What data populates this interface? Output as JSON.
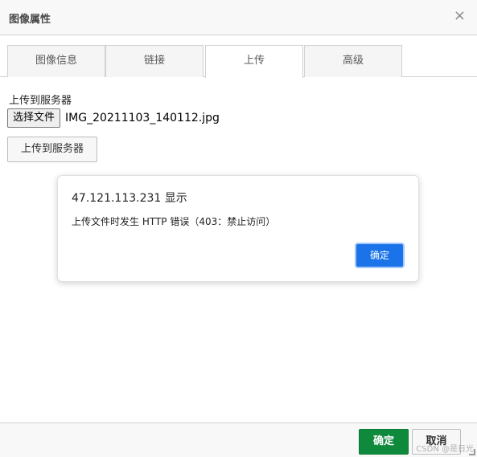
{
  "dialog": {
    "title": "图像属性",
    "close_icon": "×"
  },
  "tabs": [
    {
      "label": "图像信息",
      "active": false
    },
    {
      "label": "链接",
      "active": false
    },
    {
      "label": "上传",
      "active": true
    },
    {
      "label": "高级",
      "active": false
    }
  ],
  "upload": {
    "section_label": "上传到服务器",
    "file_button_label": "选择文件",
    "file_name": "IMG_20211103_140112.jpg",
    "upload_button_label": "上传到服务器"
  },
  "alert": {
    "title": "47.121.113.231 显示",
    "message": "上传文件时发生 HTTP 错误（403：禁止访问）",
    "ok_label": "确定",
    "ok_color": "#1a73e8"
  },
  "footer": {
    "ok_label": "确定",
    "ok_color": "#0f8a3c",
    "cancel_label": "取消"
  },
  "watermark": "CSDN @是日光"
}
